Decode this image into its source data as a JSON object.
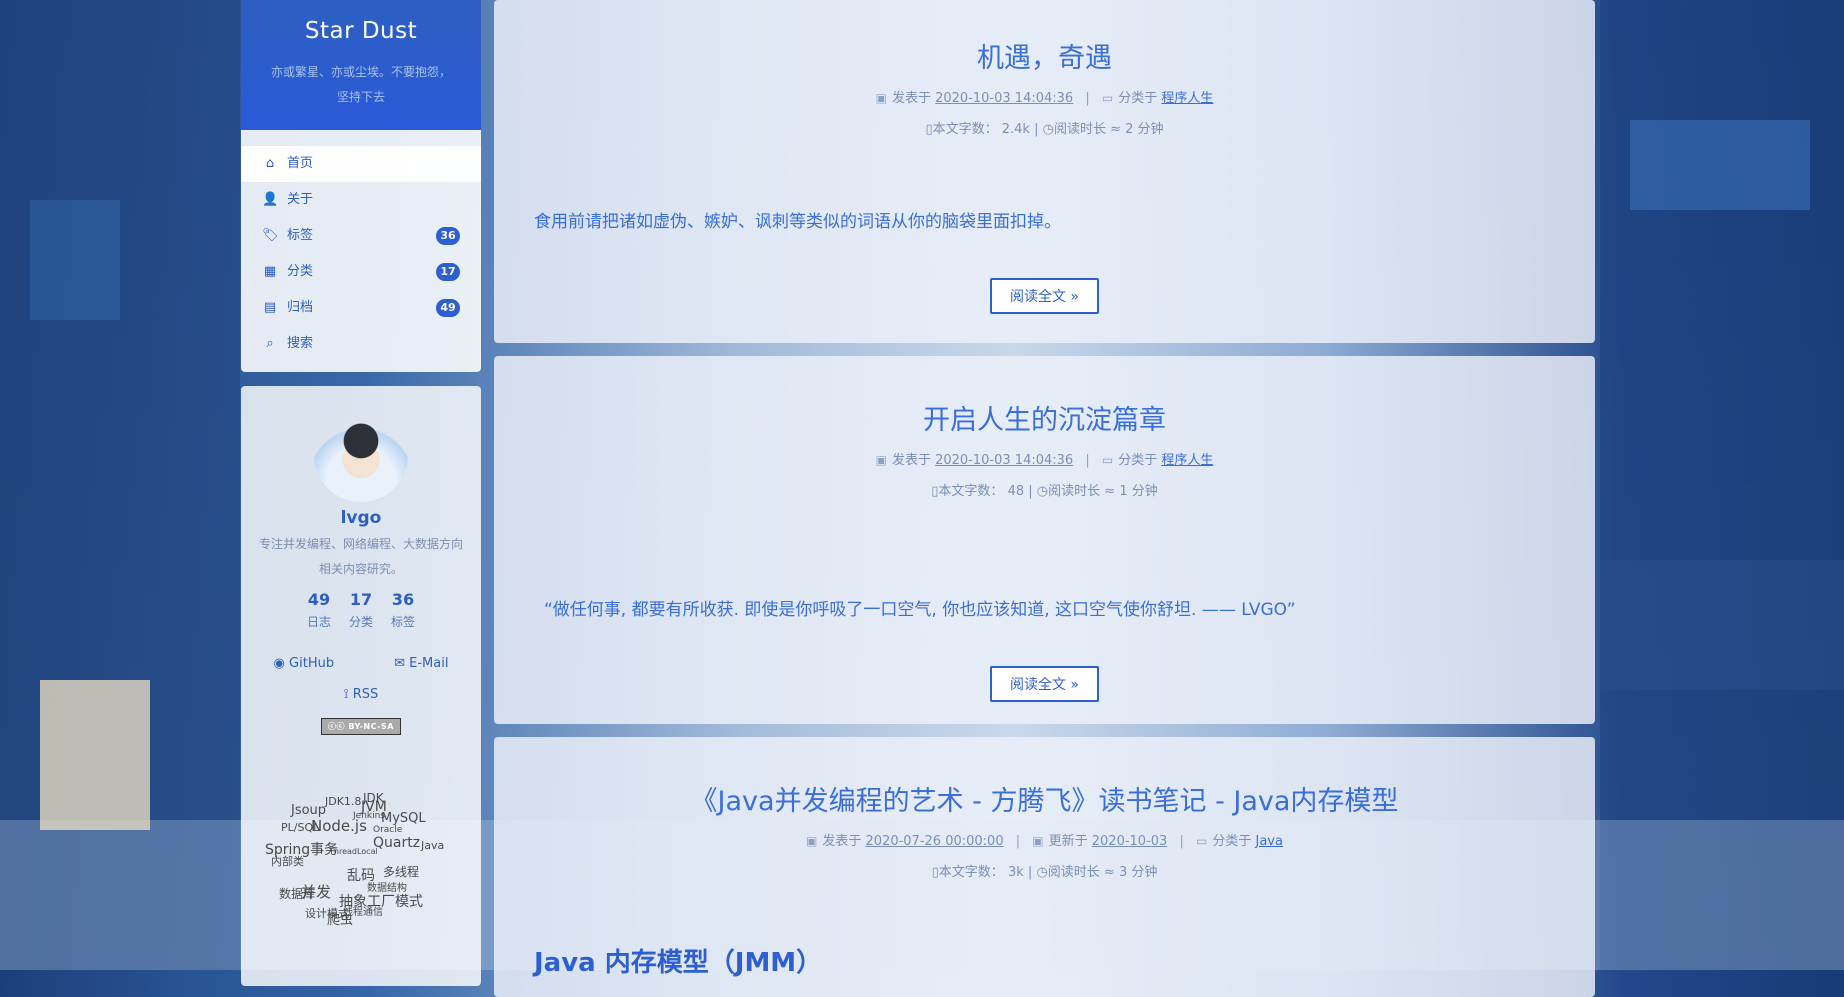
{
  "site": {
    "title": "Star Dust",
    "subtitle": "亦或繁星、亦或尘埃。不要抱怨，坚持下去"
  },
  "menu": [
    {
      "icon": "home-icon",
      "glyph": "⌂",
      "label": "首页",
      "badge": null
    },
    {
      "icon": "user-icon",
      "glyph": "👤",
      "label": "关于",
      "badge": null
    },
    {
      "icon": "tags-icon",
      "glyph": "🏷",
      "label": "标签",
      "badge": "36"
    },
    {
      "icon": "grid-icon",
      "glyph": "▦",
      "label": "分类",
      "badge": "17"
    },
    {
      "icon": "archive-icon",
      "glyph": "▤",
      "label": "归档",
      "badge": "49"
    },
    {
      "icon": "search-icon",
      "glyph": "⌕",
      "label": "搜索",
      "badge": null
    }
  ],
  "profile": {
    "name": "lvgo",
    "bio": "专注并发编程、网络编程、大数据方向相关内容研究。",
    "stats": [
      {
        "num": "49",
        "label": "日志"
      },
      {
        "num": "17",
        "label": "分类"
      },
      {
        "num": "36",
        "label": "标签"
      }
    ],
    "github": "GitHub",
    "email": "E-Mail",
    "rss": "RSS",
    "license": "BY-NC-SA"
  },
  "tag_cloud": [
    "JDK1.8",
    "JDK",
    "Jsoup",
    "JVM",
    "MySQL",
    "PL/SQL",
    "Node.js",
    "Jenkins",
    "Oracle",
    "Spring事务",
    "Quartz",
    "Java",
    "内部类",
    "ThreadLocal",
    "乱码",
    "多线程",
    "数据结构",
    "并发",
    "数据库",
    "抽象工厂模式",
    "设计模式",
    "爬虫",
    "线程通信"
  ],
  "posts": [
    {
      "title": "机遇，奇遇",
      "posted_label": "发表于",
      "posted": "2020-10-03 14:04:36",
      "category_label": "分类于",
      "category": "程序人生",
      "words_label": "本文字数：",
      "words": "2.4k",
      "time_label": "阅读时长 ≈",
      "time": "2 分钟",
      "excerpt": "食用前请把诸如虚伪、嫉妒、讽刺等类似的词语从你的脑袋里面扣掉。",
      "read_more": "阅读全文 »"
    },
    {
      "title": "开启人生的沉淀篇章",
      "posted_label": "发表于",
      "posted": "2020-10-03 14:04:36",
      "category_label": "分类于",
      "category": "程序人生",
      "words_label": "本文字数：",
      "words": "48",
      "time_label": "阅读时长 ≈",
      "time": "1 分钟",
      "excerpt": "“做任何事, 都要有所收获. 即使是你呼吸了一口空气, 你也应该知道, 这口空气使你舒坦. —— LVGO”",
      "read_more": "阅读全文 »"
    },
    {
      "title": "《Java并发编程的艺术 - 方腾飞》读书笔记 - Java内存模型",
      "posted_label": "发表于",
      "posted": "2020-07-26 00:00:00",
      "updated_label": "更新于",
      "updated": "2020-10-03",
      "category_label": "分类于",
      "category": "Java",
      "words_label": "本文字数：",
      "words": "3k",
      "time_label": "阅读时长 ≈",
      "time": "3 分钟",
      "subheading": "Java 内存模型（JMM）"
    }
  ]
}
